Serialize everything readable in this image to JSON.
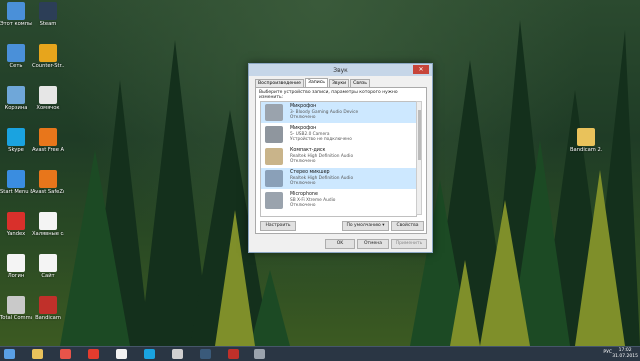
{
  "desktop": {
    "icons": [
      {
        "label": "Этот компьютер",
        "name": "this-pc"
      },
      {
        "label": "Steam",
        "name": "steam"
      },
      {
        "label": "Сеть",
        "name": "network"
      },
      {
        "label": "Counter-Str... Global Offe...",
        "name": "csgo"
      },
      {
        "label": "Корзина",
        "name": "recycle-bin"
      },
      {
        "label": "Хомячок",
        "name": "hamster"
      },
      {
        "label": "Skype",
        "name": "skype"
      },
      {
        "label": "Avast Free Antivirus",
        "name": "avast"
      },
      {
        "label": "Start Menu 8",
        "name": "start-menu-8"
      },
      {
        "label": "Avast SafeZo...",
        "name": "avast-safezone"
      },
      {
        "label": "Yandex",
        "name": "yandex"
      },
      {
        "label": "Халявные сайты",
        "name": "free-sites"
      },
      {
        "label": "Логин",
        "name": "login"
      },
      {
        "label": "Сайт",
        "name": "site"
      },
      {
        "label": "Total Command...",
        "name": "total-commander"
      },
      {
        "label": "Bandicam",
        "name": "bandicam"
      }
    ],
    "right_icon": {
      "label": "Bandicam 2.0.0.428 Th..."
    }
  },
  "dialog": {
    "title": "Звук",
    "close": "✕",
    "tabs": [
      "Воспроизведение",
      "Запись",
      "Звуки",
      "Связь"
    ],
    "active_tab": 1,
    "instruction": "Выберите устройство записи, параметры которого нужно изменить:",
    "devices": [
      {
        "name": "Микрофон",
        "desc": "3- Bloody Gaming Audio Device",
        "status": "Отключено",
        "selected": true,
        "color": "#9aa3ad"
      },
      {
        "name": "Микрофон",
        "desc": "5- USB2.0 Camera",
        "status": "Устройство не подключено",
        "selected": false,
        "color": "#8f969e"
      },
      {
        "name": "Компакт-диск",
        "desc": "Realtek High Definition Audio",
        "status": "Отключено",
        "selected": false,
        "color": "#c9b48a"
      },
      {
        "name": "Стерео микшер",
        "desc": "Realtek High Definition Audio",
        "status": "Отключено",
        "selected": true,
        "color": "#8aa0b8"
      },
      {
        "name": "Microphone",
        "desc": "SB X-Fi Xtreme Audio",
        "status": "Отключено",
        "selected": false,
        "color": "#9aa3ad"
      }
    ],
    "buttons": {
      "configure": "Настроить",
      "default": "По умолчанию ▾",
      "properties": "Свойства",
      "ok": "OK",
      "cancel": "Отмена",
      "apply": "Применить"
    }
  },
  "taskbar": {
    "tray_lang": "РУС",
    "time": "17:02",
    "date": "31.07.2015"
  },
  "colors": {
    "taskbar": "#2a3644",
    "selection": "#cde8ff"
  }
}
